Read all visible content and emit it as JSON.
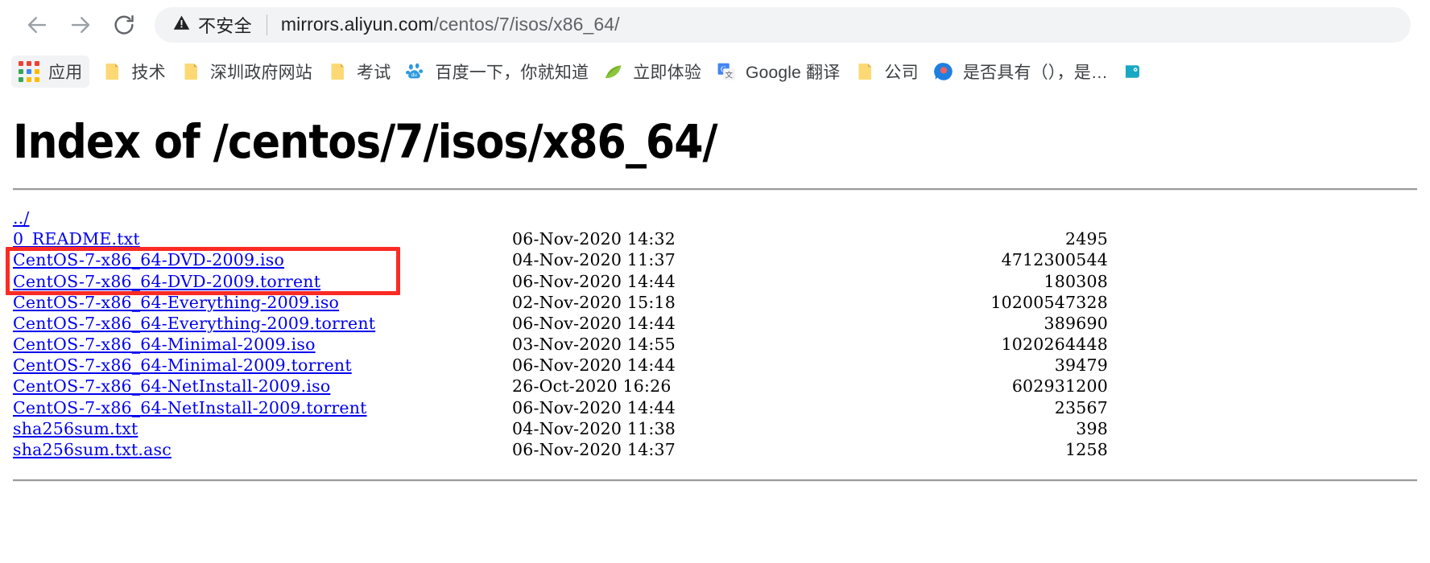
{
  "browser": {
    "back_icon": "arrow-left-icon",
    "forward_icon": "arrow-right-icon",
    "reload_icon": "reload-icon",
    "security_warning_icon": "warning-triangle-icon",
    "security_text": "不安全",
    "url_host": "mirrors.aliyun.com",
    "url_path": "/centos/7/isos/x86_64/",
    "url_full": "mirrors.aliyun.com/centos/7/isos/x86_64/"
  },
  "bookmarks": [
    {
      "label": "应用",
      "icon": "apps-grid-icon",
      "type": "apps"
    },
    {
      "label": "技术",
      "icon": "folder-icon",
      "type": "folder"
    },
    {
      "label": "深圳政府网站",
      "icon": "folder-icon",
      "type": "folder"
    },
    {
      "label": "考试",
      "icon": "folder-icon",
      "type": "folder"
    },
    {
      "label": "百度一下，你就知道",
      "icon": "baidu-paw-icon",
      "type": "site"
    },
    {
      "label": "立即体验",
      "icon": "green-leaf-icon",
      "type": "site"
    },
    {
      "label": "Google 翻译",
      "icon": "google-translate-icon",
      "type": "site"
    },
    {
      "label": "公司",
      "icon": "folder-icon",
      "type": "folder"
    },
    {
      "label": "是否具有（），是…",
      "icon": "blue-circle-icon",
      "type": "site"
    },
    {
      "label": "",
      "icon": "partial-cut-icon",
      "type": "site"
    }
  ],
  "page": {
    "title": "Index of /centos/7/isos/x86_64/",
    "parent_link": "../",
    "link_color": "#0000ee"
  },
  "listing": [
    {
      "name": "0_README.txt",
      "date": "06-Nov-2020 14:32",
      "size": "2495"
    },
    {
      "name": "CentOS-7-x86_64-DVD-2009.iso",
      "date": "04-Nov-2020 11:37",
      "size": "4712300544"
    },
    {
      "name": "CentOS-7-x86_64-DVD-2009.torrent",
      "date": "06-Nov-2020 14:44",
      "size": "180308"
    },
    {
      "name": "CentOS-7-x86_64-Everything-2009.iso",
      "date": "02-Nov-2020 15:18",
      "size": "10200547328"
    },
    {
      "name": "CentOS-7-x86_64-Everything-2009.torrent",
      "date": "06-Nov-2020 14:44",
      "size": "389690"
    },
    {
      "name": "CentOS-7-x86_64-Minimal-2009.iso",
      "date": "03-Nov-2020 14:55",
      "size": "1020264448"
    },
    {
      "name": "CentOS-7-x86_64-Minimal-2009.torrent",
      "date": "06-Nov-2020 14:44",
      "size": "39479"
    },
    {
      "name": "CentOS-7-x86_64-NetInstall-2009.iso",
      "date": "26-Oct-2020 16:26",
      "size": "602931200"
    },
    {
      "name": "CentOS-7-x86_64-NetInstall-2009.torrent",
      "date": "06-Nov-2020 14:44",
      "size": "23567"
    },
    {
      "name": "sha256sum.txt",
      "date": "04-Nov-2020 11:38",
      "size": "398"
    },
    {
      "name": "sha256sum.txt.asc",
      "date": "06-Nov-2020 14:37",
      "size": "1258"
    }
  ],
  "annotation": {
    "color": "#fb2b24",
    "highlights": [
      "CentOS-7-x86_64-DVD-2009.iso",
      "CentOS-7-x86_64-DVD-2009.torrent"
    ]
  }
}
